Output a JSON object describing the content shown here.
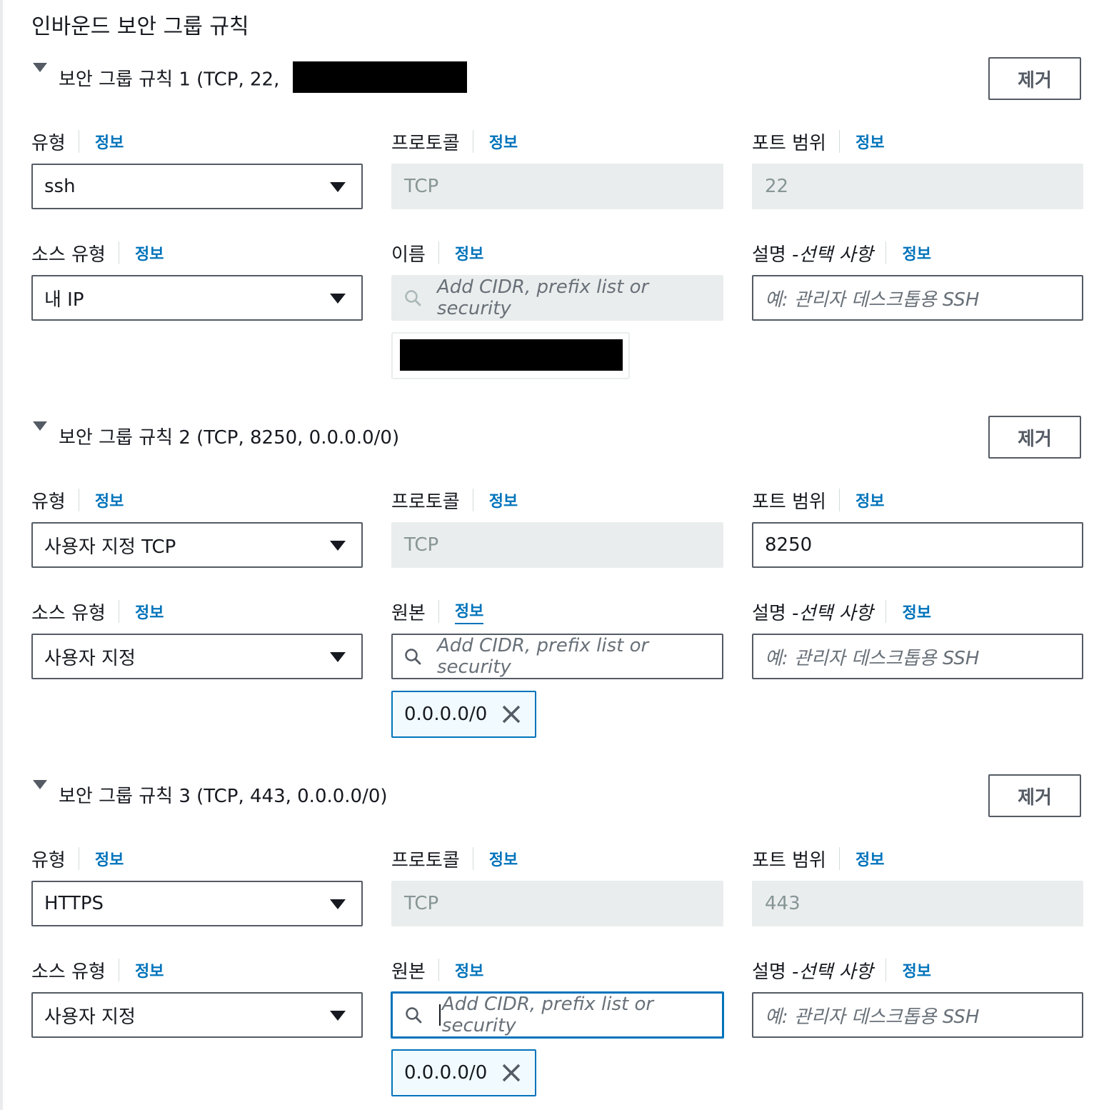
{
  "section_title": "인바운드 보안 그룹 규칙",
  "info_label": "정보",
  "remove_label": "제거",
  "labels": {
    "type": "유형",
    "protocol": "프로토콜",
    "port_range": "포트 범위",
    "source_type": "소스 유형",
    "name": "이름",
    "source": "원본",
    "description_prefix": "설명 - ",
    "description_optional": "선택 사항"
  },
  "search_placeholder": "Add CIDR, prefix list or security",
  "description_placeholder": "예: 관리자 데스크톱용 SSH",
  "rules": [
    {
      "title_prefix": "보안 그룹 규칙 1 (TCP, 22, ",
      "title_suffix": ")",
      "type": "ssh",
      "protocol": "TCP",
      "port": "22",
      "source_type": "내 IP"
    },
    {
      "title": "보안 그룹 규칙 2 (TCP, 8250, 0.0.0.0/0)",
      "type": "사용자 지정 TCP",
      "protocol": "TCP",
      "port": "8250",
      "source_type": "사용자 지정",
      "token": "0.0.0.0/0"
    },
    {
      "title": "보안 그룹 규칙 3 (TCP, 443, 0.0.0.0/0)",
      "type": "HTTPS",
      "protocol": "TCP",
      "port": "443",
      "source_type": "사용자 지정",
      "token": "0.0.0.0/0"
    }
  ],
  "colors": {
    "link": "#0073bb",
    "border": "#545b64",
    "disabled_bg": "#eaeded",
    "token_bg": "#f1faff"
  }
}
